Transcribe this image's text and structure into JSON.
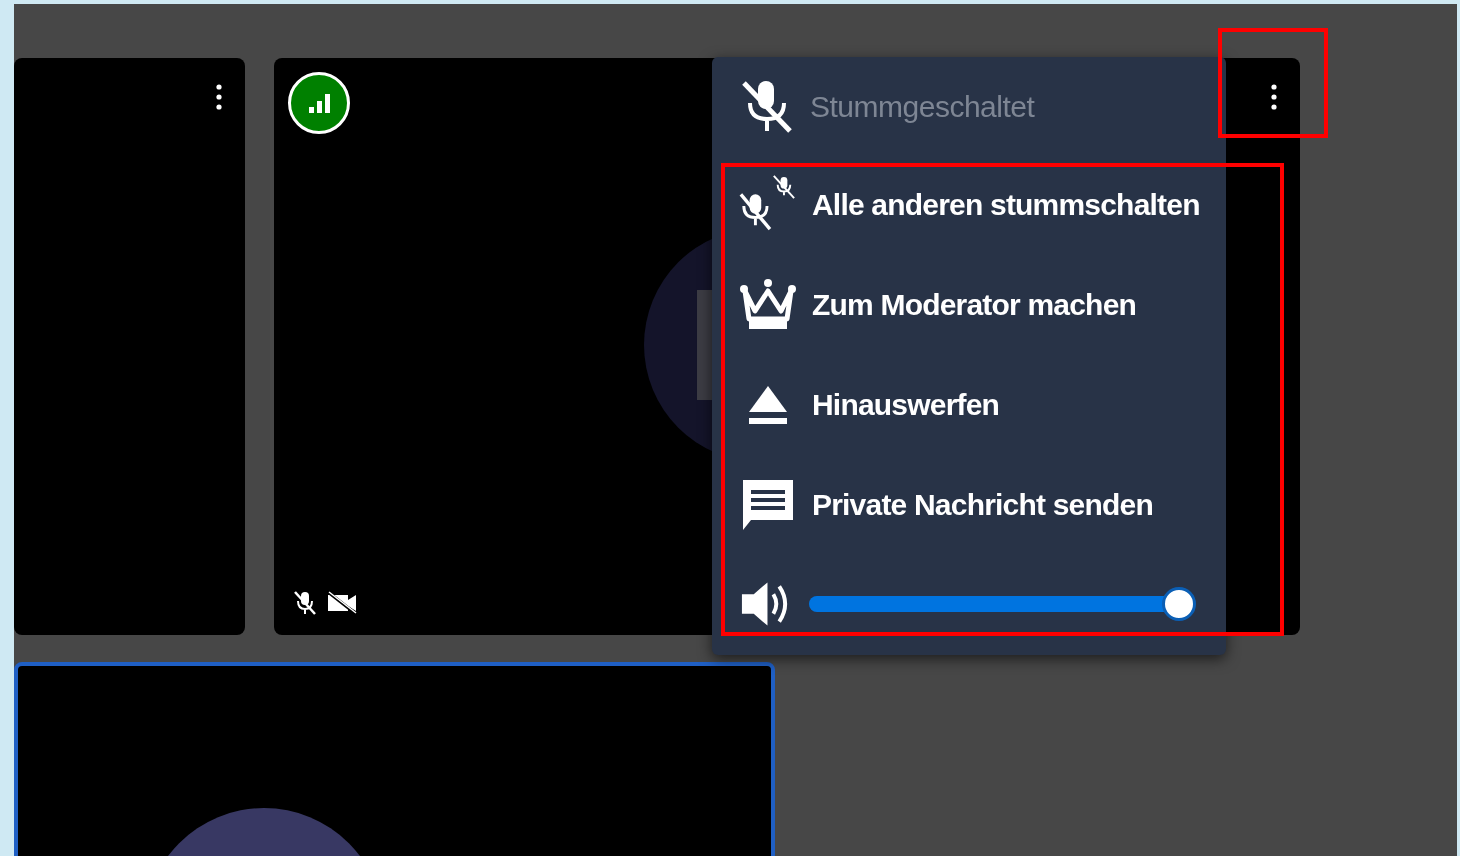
{
  "tiles": [
    {
      "selected": false,
      "indicators": [
        {
          "kind": "more"
        }
      ]
    },
    {
      "selected": false,
      "indicators": [
        {
          "kind": "avatar"
        },
        {
          "kind": "connection"
        },
        {
          "kind": "more"
        },
        {
          "kind": "mic-muted"
        },
        {
          "kind": "video-muted"
        }
      ]
    },
    {
      "selected": true,
      "indicators": [
        {
          "kind": "avatar"
        }
      ]
    }
  ],
  "participant_menu": {
    "status": {
      "label": "Stummgeschaltet",
      "disabled": true
    },
    "items": [
      {
        "kind": "mute-all",
        "label": "Alle anderen stummschalten"
      },
      {
        "kind": "moderator",
        "label": "Zum Moderator machen"
      },
      {
        "kind": "kick",
        "label": "Hinauswerfen"
      },
      {
        "kind": "message",
        "label": "Private Nachricht senden"
      }
    ],
    "volume": {
      "level": 0.97
    }
  }
}
